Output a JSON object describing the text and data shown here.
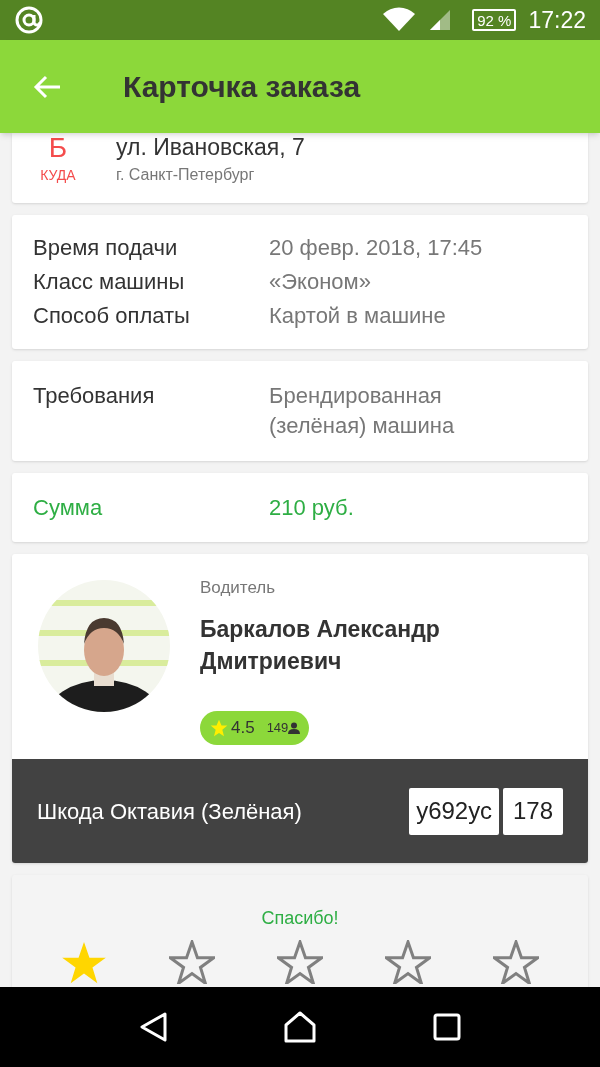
{
  "status_bar": {
    "battery": "92 %",
    "time": "17:22"
  },
  "app_bar": {
    "title": "Карточка заказа"
  },
  "destination": {
    "letter": "Б",
    "label": "КУДА",
    "address": "ул. Ивановская, 7",
    "city": "г. Санкт-Петербург"
  },
  "details": [
    {
      "label": "Время подачи",
      "value": "20 февр. 2018, 17:45"
    },
    {
      "label": "Класс машины",
      "value": "«Эконом»"
    },
    {
      "label": "Способ оплаты",
      "value": "Картой в машине"
    }
  ],
  "requirements": {
    "label": "Требования",
    "value": "Брендированная (зелёная) машина"
  },
  "total": {
    "label": "Сумма",
    "value": "210 руб."
  },
  "driver": {
    "role": "Водитель",
    "name": "Баркалов Александр Дмитриевич",
    "rating": "4.5",
    "reviews": "149"
  },
  "car": {
    "model": "Шкода Октавия (Зелёная)",
    "plate": "у692ус",
    "region": "178"
  },
  "feedback": {
    "message": "Спасибо!",
    "stars": 1
  }
}
